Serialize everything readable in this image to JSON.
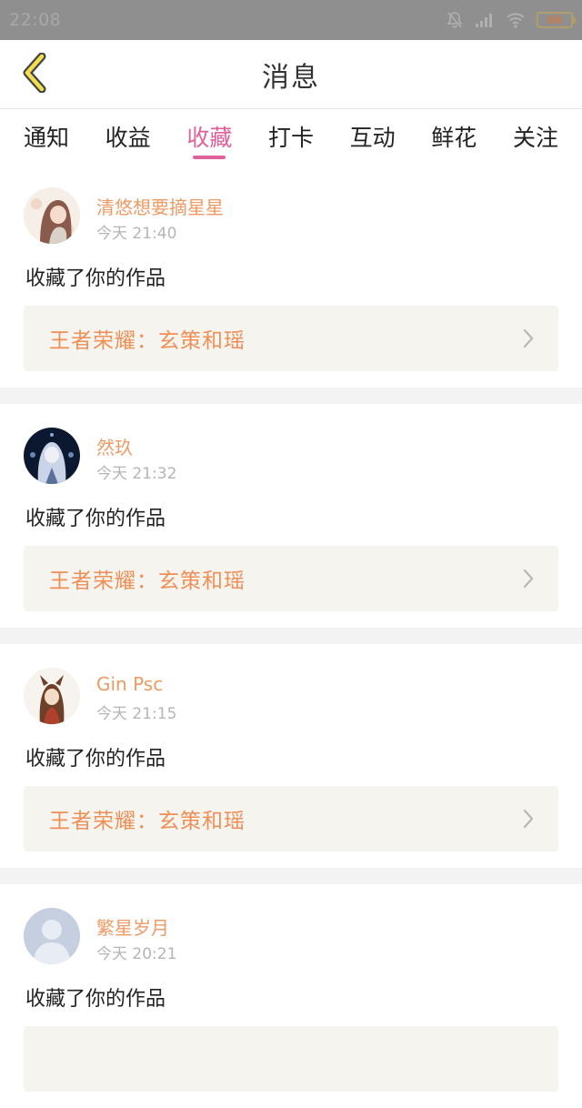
{
  "status": {
    "time": "22:08",
    "battery": "66"
  },
  "header": {
    "title": "消息"
  },
  "tabs": [
    {
      "label": "通知"
    },
    {
      "label": "收益"
    },
    {
      "label": "收藏",
      "active": true
    },
    {
      "label": "打卡"
    },
    {
      "label": "互动"
    },
    {
      "label": "鲜花"
    },
    {
      "label": "关注"
    }
  ],
  "items": [
    {
      "username": "清悠想要摘星星",
      "time": "今天 21:40",
      "action": "收藏了你的作品",
      "work": "王者荣耀：玄策和瑶"
    },
    {
      "username": "然玖",
      "time": "今天 21:32",
      "action": "收藏了你的作品",
      "work": "王者荣耀：玄策和瑶"
    },
    {
      "username": "Gin Psc",
      "time": "今天 21:15",
      "action": "收藏了你的作品",
      "work": "王者荣耀：玄策和瑶"
    },
    {
      "username": "繁星岁月",
      "time": "今天 20:21",
      "action": "收藏了你的作品",
      "work": ""
    }
  ],
  "colors": {
    "accent": "#e0609a",
    "username": "#ef9a64",
    "work_title": "#ef8f58"
  }
}
